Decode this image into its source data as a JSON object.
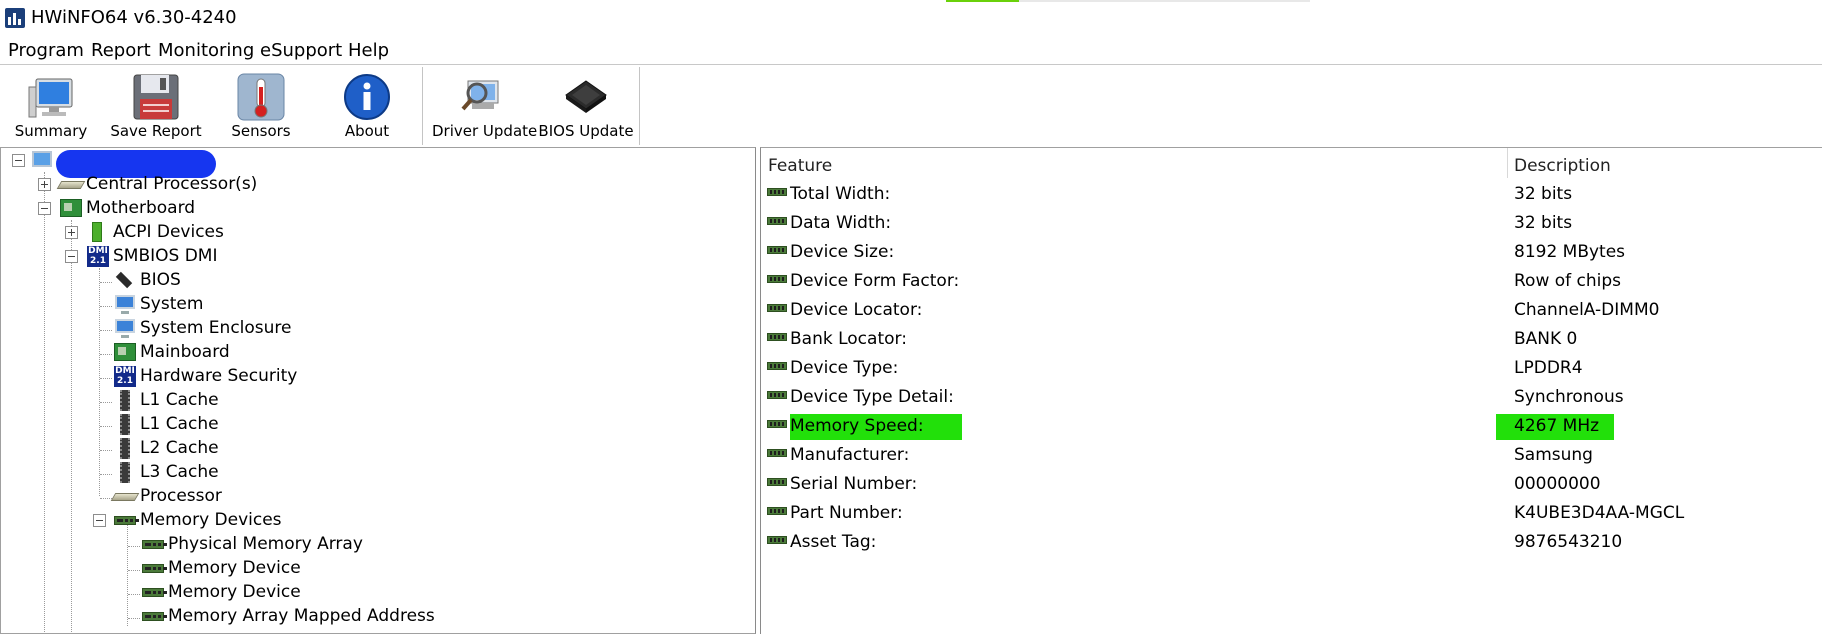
{
  "window": {
    "title": "HWiNFO64 v6.30-4240",
    "progress_fraction": 0.2,
    "progress_color": "#6ad10a"
  },
  "menu": [
    "Program",
    "Report",
    "Monitoring",
    "eSupport",
    "Help"
  ],
  "toolbar": {
    "buttons": [
      {
        "label": "Summary",
        "icon": "monitor-icon"
      },
      {
        "label": "Save Report",
        "icon": "floppy-disk-icon"
      },
      {
        "label": "Sensors",
        "icon": "thermometer-icon"
      },
      {
        "label": "About",
        "icon": "info-icon"
      },
      {
        "label": "Driver Update",
        "icon": "driver-update-icon"
      },
      {
        "label": "BIOS Update",
        "icon": "chip-icon"
      }
    ]
  },
  "tree": {
    "root_label": "",
    "items": [
      {
        "label": "Central Processor(s)",
        "icon": "cpu-icon"
      },
      {
        "label": "Motherboard",
        "icon": "motherboard-icon"
      },
      {
        "label": "ACPI Devices",
        "icon": "acpi-icon"
      },
      {
        "label": "SMBIOS DMI",
        "icon": "dmi-icon"
      },
      {
        "label": "BIOS",
        "icon": "chip-icon"
      },
      {
        "label": "System",
        "icon": "monitor-icon"
      },
      {
        "label": "System Enclosure",
        "icon": "monitor-icon"
      },
      {
        "label": "Mainboard",
        "icon": "motherboard-icon"
      },
      {
        "label": "Hardware Security",
        "icon": "dmi-icon"
      },
      {
        "label": "L1 Cache",
        "icon": "cache-icon"
      },
      {
        "label": "L1 Cache",
        "icon": "cache-icon"
      },
      {
        "label": "L2 Cache",
        "icon": "cache-icon"
      },
      {
        "label": "L3 Cache",
        "icon": "cache-icon"
      },
      {
        "label": "Processor",
        "icon": "cpu-icon"
      },
      {
        "label": "Memory Devices",
        "icon": "ram-icon"
      },
      {
        "label": "Physical Memory Array",
        "icon": "ram-icon"
      },
      {
        "label": "Memory Device",
        "icon": "ram-icon"
      },
      {
        "label": "Memory Device",
        "icon": "ram-icon"
      },
      {
        "label": "Memory Array Mapped Address",
        "icon": "ram-icon"
      }
    ]
  },
  "details": {
    "headers": {
      "feature": "Feature",
      "description": "Description"
    },
    "highlight_color": "#22e00a",
    "rows": [
      {
        "feature": "Total Width:",
        "description": "32 bits"
      },
      {
        "feature": "Data Width:",
        "description": "32 bits"
      },
      {
        "feature": "Device Size:",
        "description": "8192 MBytes"
      },
      {
        "feature": "Device Form Factor:",
        "description": "Row of chips"
      },
      {
        "feature": "Device Locator:",
        "description": "ChannelA-DIMM0"
      },
      {
        "feature": "Bank Locator:",
        "description": "BANK 0"
      },
      {
        "feature": "Device Type:",
        "description": "LPDDR4"
      },
      {
        "feature": "Device Type Detail:",
        "description": "Synchronous"
      },
      {
        "feature": "Memory Speed:",
        "description": "4267 MHz",
        "highlighted": true
      },
      {
        "feature": "Manufacturer:",
        "description": "Samsung"
      },
      {
        "feature": "Serial Number:",
        "description": "00000000"
      },
      {
        "feature": "Part Number:",
        "description": "K4UBE3D4AA-MGCL"
      },
      {
        "feature": "Asset Tag:",
        "description": "9876543210"
      }
    ]
  }
}
